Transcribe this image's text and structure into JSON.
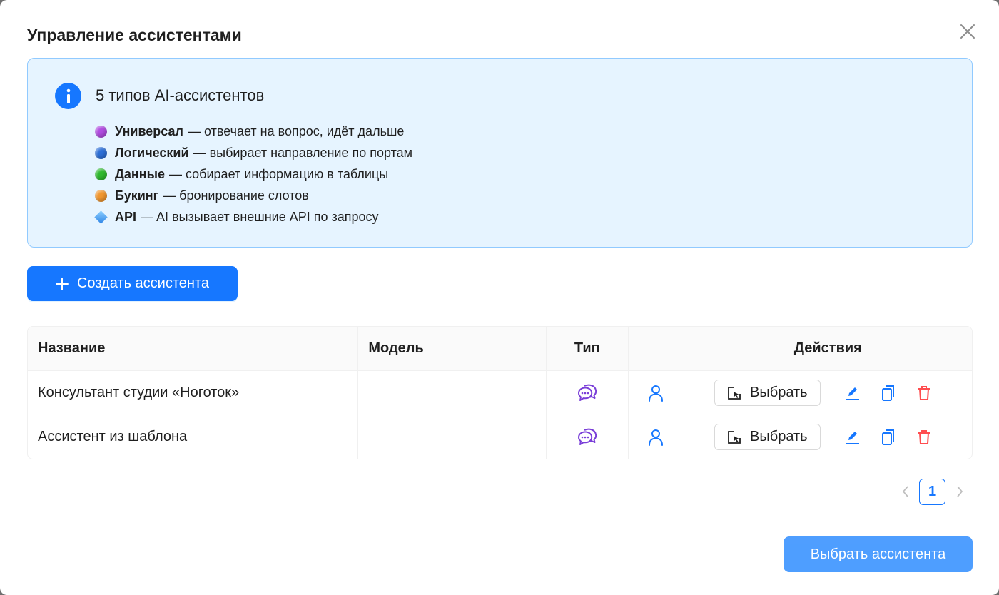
{
  "modal": {
    "title": "Управление ассистентами"
  },
  "info": {
    "title": "5 типов AI-ассистентов",
    "types": [
      {
        "name": "Универсал",
        "desc": "— отвечает на вопрос, идёт дальше",
        "color": "#b04ce0"
      },
      {
        "name": "Логический",
        "desc": "— выбирает направление по портам",
        "color": "#2d6fd6"
      },
      {
        "name": "Данные",
        "desc": "— собирает информацию в таблицы",
        "color": "#2fb82f"
      },
      {
        "name": "Букинг",
        "desc": "— бронирование слотов",
        "color": "#f0962f"
      },
      {
        "name": "API",
        "desc": "— AI вызывает внешние API по запросу",
        "color": "#3b92e8"
      }
    ]
  },
  "create_button": {
    "label": "Создать ассистента"
  },
  "table": {
    "columns": [
      "Название",
      "Модель",
      "Тип",
      "",
      "Действия"
    ],
    "rows": [
      {
        "name": "Консультант студии «Ноготок»",
        "model": "",
        "type_icon": "chat-bubble-icon",
        "select_label": "Выбрать"
      },
      {
        "name": "Ассистент из шаблона",
        "model": "",
        "type_icon": "chat-bubble-icon",
        "select_label": "Выбрать"
      }
    ]
  },
  "pagination": {
    "current_page": "1"
  },
  "footer": {
    "choose_label": "Выбрать ассистента"
  },
  "colors": {
    "primary": "#1677ff",
    "info_bg": "#e6f4ff",
    "info_border": "#91caff",
    "type_icon": "#7a3fd8",
    "delete": "#ff4d4f"
  }
}
